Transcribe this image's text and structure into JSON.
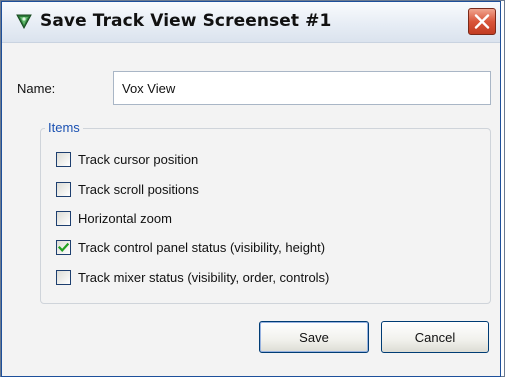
{
  "window": {
    "title": "Save Track View Screenset #1"
  },
  "form": {
    "name_label": "Name:",
    "name_value": "Vox View"
  },
  "items_group": {
    "label": "Items",
    "options": [
      {
        "label": "Track cursor position",
        "checked": false
      },
      {
        "label": "Track scroll positions",
        "checked": false
      },
      {
        "label": "Horizontal zoom",
        "checked": false
      },
      {
        "label": "Track control panel status (visibility, height)",
        "checked": true
      },
      {
        "label": "Track mixer status (visibility, order, controls)",
        "checked": false
      }
    ]
  },
  "buttons": {
    "save": "Save",
    "cancel": "Cancel"
  },
  "icons": {
    "app": "reaper-logo-icon",
    "close": "close-icon",
    "check": "checkmark-icon"
  },
  "colors": {
    "accent": "#1c52b2",
    "close_button": "#d9553a",
    "check_mark": "#21a121"
  }
}
